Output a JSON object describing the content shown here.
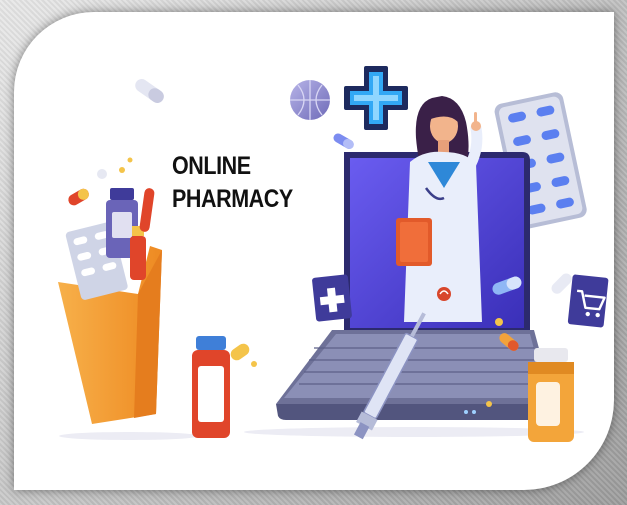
{
  "banner": {
    "title_line1": "ONLINE",
    "title_line2": "PHARMACY"
  },
  "colors": {
    "laptop_screen": "#4a3fd8",
    "laptop_body": "#6b6f96",
    "bag": "#f29a2e",
    "cross": "#2f9cf0",
    "pill_blue": "#6fb6f5",
    "bottle_orange": "#f2a23a"
  },
  "icons": [
    "medical-cross-icon",
    "shopping-cart-icon",
    "capsule-icon",
    "syringe-icon"
  ]
}
